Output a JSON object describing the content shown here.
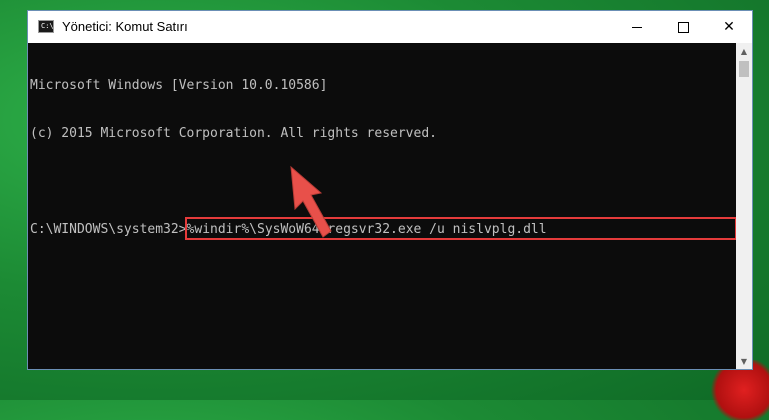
{
  "window": {
    "title": "Yönetici: Komut Satırı",
    "icon_label": "C:\\",
    "controls": {
      "minimize": "minimize",
      "maximize": "maximize",
      "close": "✕"
    }
  },
  "console": {
    "lines": [
      "Microsoft Windows [Version 10.0.10586]",
      "(c) 2015 Microsoft Corporation. All rights reserved."
    ],
    "prompt": "C:\\WINDOWS\\system32>",
    "command": "%windir%\\SysWoW64\\regsvr32.exe /u nislvplg.dll"
  },
  "colors": {
    "console_bg": "#0c0c0c",
    "console_text": "#c0c0c0",
    "highlight": "#e53b3b",
    "arrow": "#e8504a"
  },
  "icons": [
    "cmd-icon",
    "minimize-icon",
    "maximize-icon",
    "close-icon",
    "scroll-up-icon",
    "scroll-down-icon",
    "pointer-arrow"
  ]
}
